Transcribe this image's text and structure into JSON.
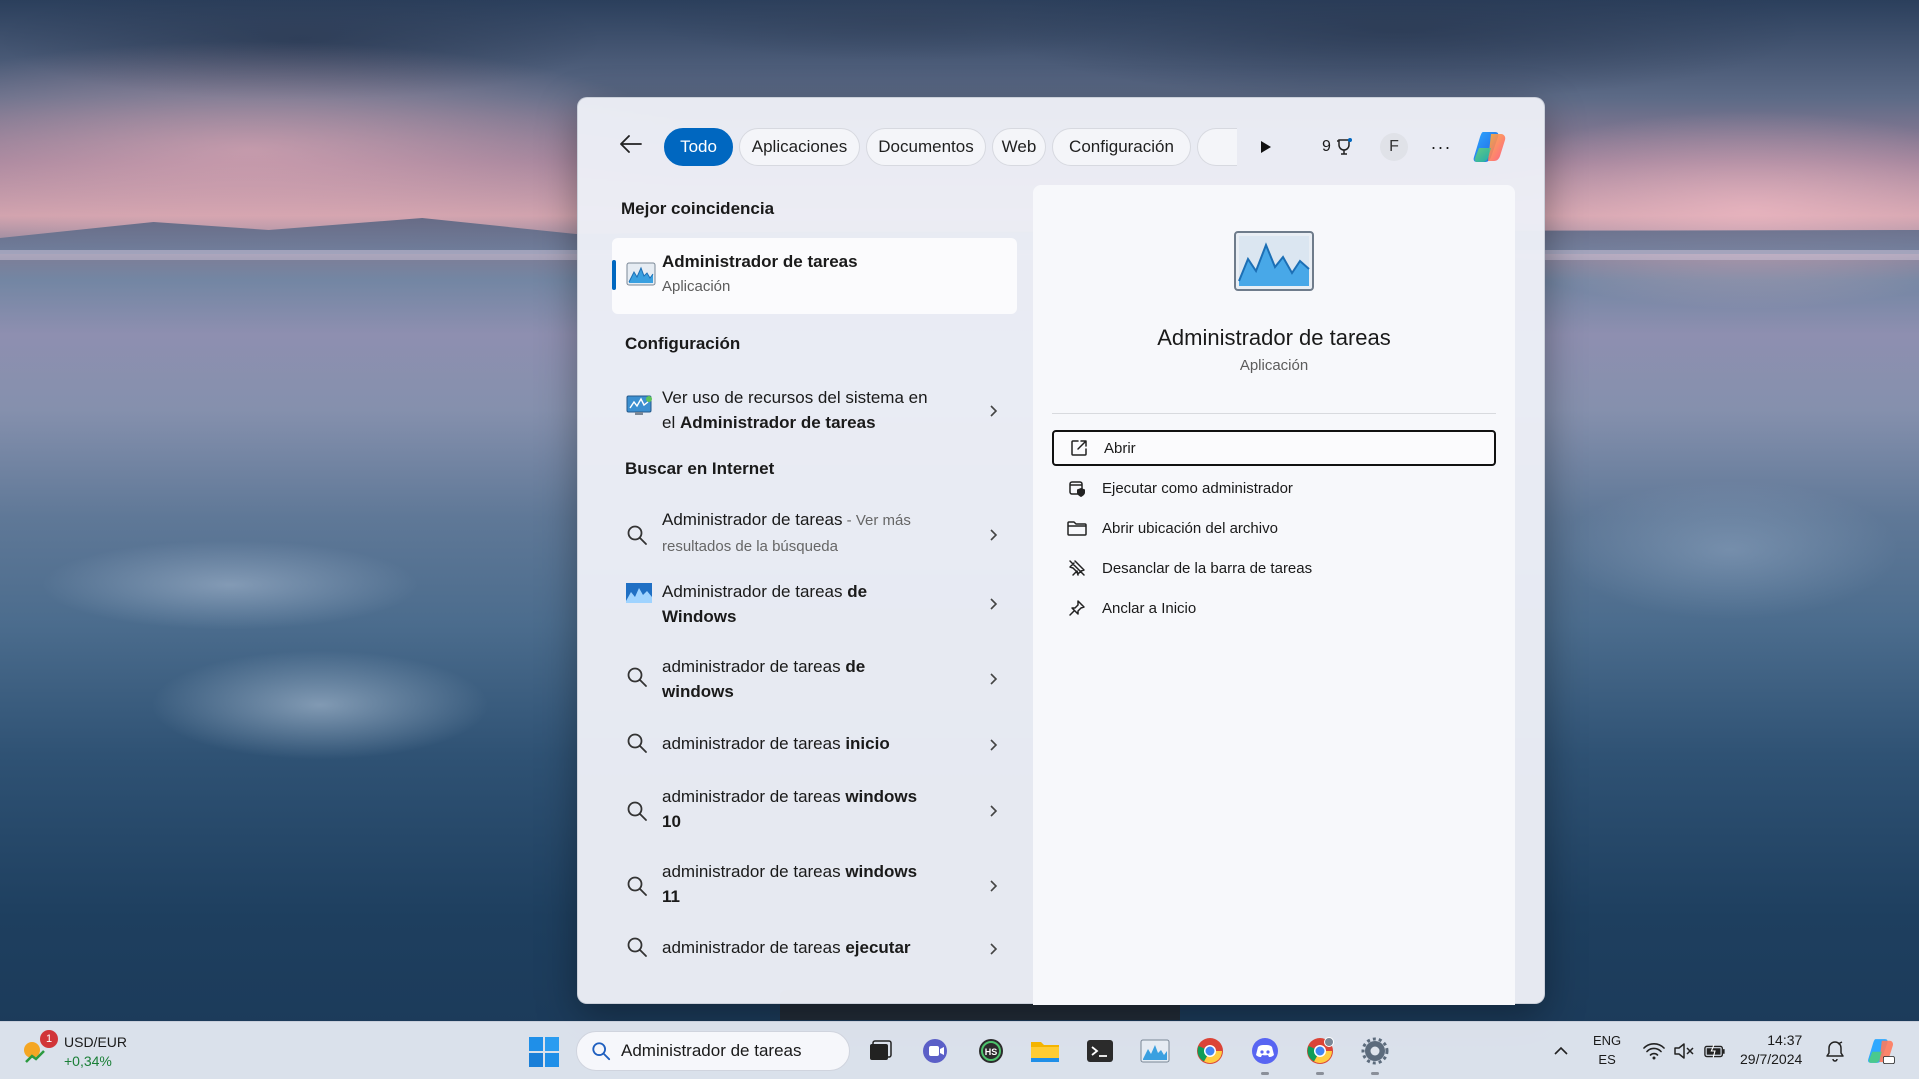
{
  "search_panel": {
    "tabs": [
      {
        "label": "Todo",
        "active": true
      },
      {
        "label": "Aplicaciones",
        "active": false
      },
      {
        "label": "Documentos",
        "active": false
      },
      {
        "label": "Web",
        "active": false
      },
      {
        "label": "Configuración",
        "active": false
      }
    ],
    "rewards_points": "9",
    "profile_initial": "F",
    "more_label": "···",
    "best_match": {
      "heading": "Mejor coincidencia",
      "title": "Administrador de tareas",
      "subtitle": "Aplicación"
    },
    "settings_section": {
      "heading": "Configuración",
      "item": {
        "line1": "Ver uso de recursos del sistema en",
        "line2_prefix": "el ",
        "line2_bold": "Administrador de tareas"
      }
    },
    "web_section": {
      "heading": "Buscar en Internet",
      "items": [
        {
          "icon": "search-icon",
          "main": "Administrador de tareas",
          "suffix": " - Ver más",
          "second_line": "resultados de la búsqueda"
        },
        {
          "icon": "task-manager-web-icon",
          "line1_plain": "Administrador de tareas ",
          "line1_bold": "de",
          "line2_bold": "Windows"
        },
        {
          "icon": "search-icon",
          "line1_plain": "administrador de tareas ",
          "line1_bold": "de",
          "line2_bold": "windows"
        },
        {
          "icon": "search-icon",
          "line1_plain": "administrador de tareas ",
          "line1_bold": "inicio"
        },
        {
          "icon": "search-icon",
          "line1_plain": "administrador de tareas ",
          "line1_bold": "windows",
          "line2_bold": "10"
        },
        {
          "icon": "search-icon",
          "line1_plain": "administrador de tareas ",
          "line1_bold": "windows",
          "line2_bold": "11"
        },
        {
          "icon": "search-icon",
          "line1_plain": "administrador de tareas ",
          "line1_bold": "ejecutar"
        }
      ]
    },
    "detail": {
      "title": "Administrador de tareas",
      "subtitle": "Aplicación",
      "actions": [
        {
          "label": "Abrir",
          "icon": "open-external-icon"
        },
        {
          "label": "Ejecutar como administrador",
          "icon": "run-as-admin-icon"
        },
        {
          "label": "Abrir ubicación del archivo",
          "icon": "folder-icon"
        },
        {
          "label": "Desanclar de la barra de tareas",
          "icon": "unpin-icon"
        },
        {
          "label": "Anclar a Inicio",
          "icon": "pin-icon"
        }
      ]
    }
  },
  "taskbar": {
    "widget": {
      "pair": "USD/EUR",
      "change": "+0,34%",
      "badge": "1"
    },
    "search_text": "Administrador de tareas",
    "apps": [
      "task-view-icon",
      "teams-icon",
      "hs-app-icon",
      "file-explorer-icon",
      "terminal-icon",
      "task-manager-icon",
      "chrome-icon",
      "discord-icon",
      "chrome-profile-icon",
      "settings-icon"
    ],
    "language": {
      "line1": "ENG",
      "line2": "ES"
    },
    "time": "14:37",
    "date": "29/7/2024"
  },
  "colors": {
    "accent": "#0067c0",
    "positive": "#1a7f37",
    "badge": "#d13438"
  }
}
